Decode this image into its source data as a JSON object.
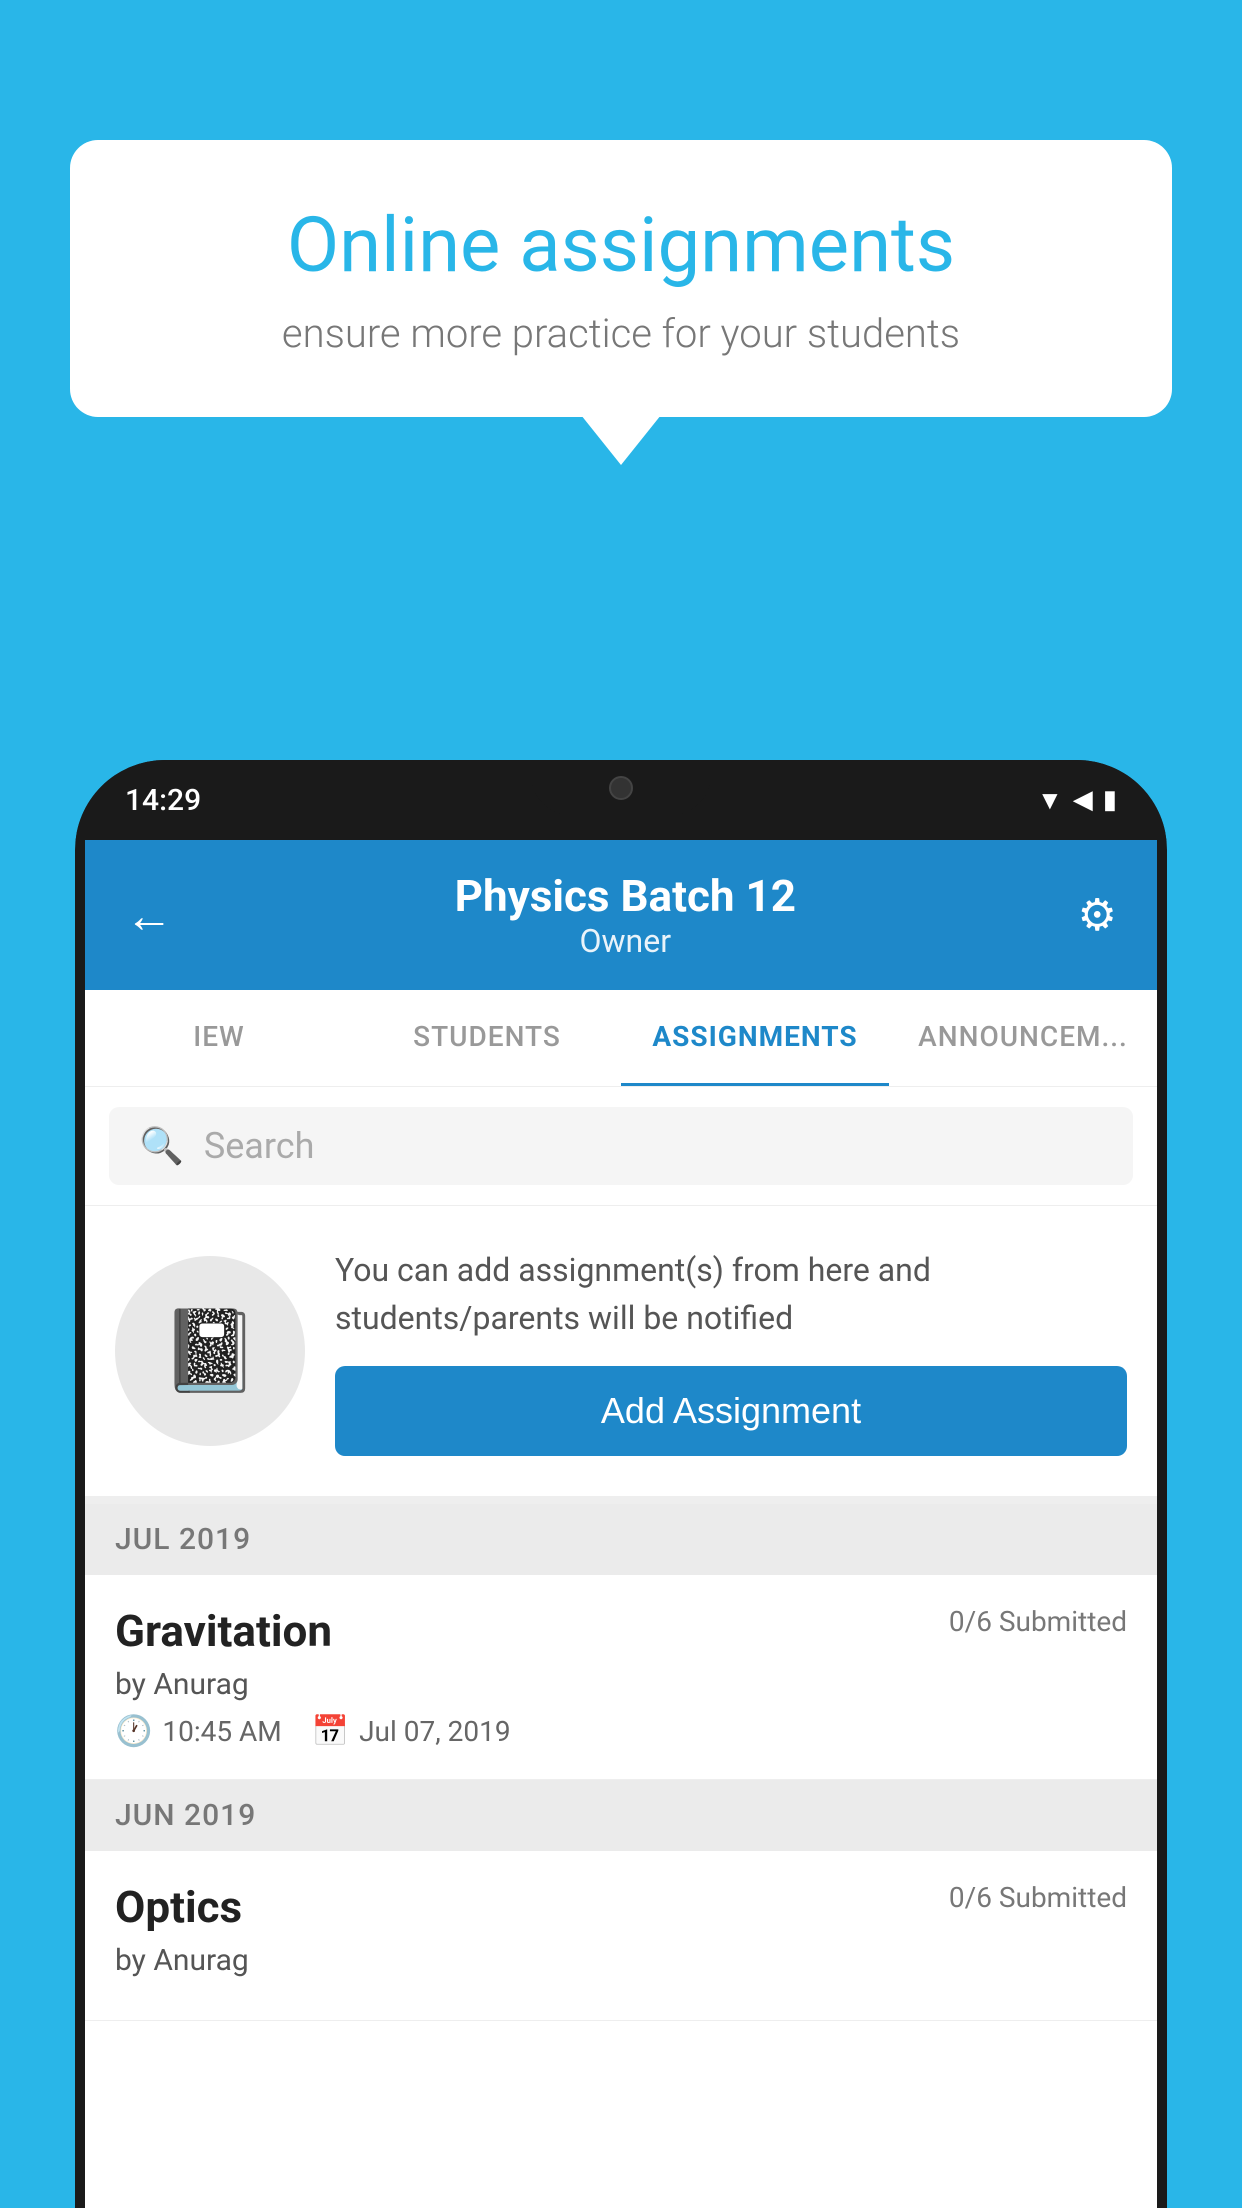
{
  "background_color": "#29B6E8",
  "speech_bubble": {
    "title": "Online assignments",
    "subtitle": "ensure more practice for your students"
  },
  "status_bar": {
    "time": "14:29",
    "wifi_icon": "▲",
    "signal_icon": "▲",
    "battery_icon": "▮"
  },
  "header": {
    "title": "Physics Batch 12",
    "subtitle": "Owner",
    "back_label": "←",
    "settings_label": "⚙"
  },
  "tabs": [
    {
      "label": "IEW",
      "active": false
    },
    {
      "label": "STUDENTS",
      "active": false
    },
    {
      "label": "ASSIGNMENTS",
      "active": true
    },
    {
      "label": "ANNOUNCEM...",
      "active": false
    }
  ],
  "search": {
    "placeholder": "Search"
  },
  "promo": {
    "text": "You can add assignment(s) from here and students/parents will be notified",
    "button_label": "Add Assignment"
  },
  "month_sections": [
    {
      "month_label": "JUL 2019",
      "assignments": [
        {
          "title": "Gravitation",
          "submitted": "0/6 Submitted",
          "by": "by Anurag",
          "time": "10:45 AM",
          "date": "Jul 07, 2019"
        }
      ]
    },
    {
      "month_label": "JUN 2019",
      "assignments": [
        {
          "title": "Optics",
          "submitted": "0/6 Submitted",
          "by": "by Anurag",
          "time": "",
          "date": ""
        }
      ]
    }
  ]
}
